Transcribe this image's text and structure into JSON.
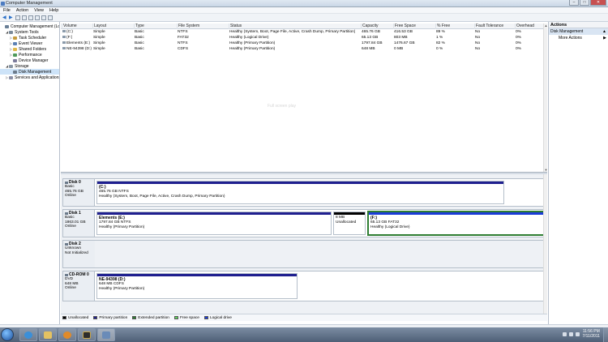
{
  "window": {
    "title": "Computer Management"
  },
  "menu": [
    "File",
    "Action",
    "View",
    "Help"
  ],
  "tree": [
    {
      "label": "Computer Management (Local)",
      "level": 0,
      "expander": "",
      "icon": "computer-icon",
      "color": "#6a7f96"
    },
    {
      "label": "System Tools",
      "level": 1,
      "expander": "◢",
      "icon": "tools-icon",
      "color": "#7a8a9a"
    },
    {
      "label": "Task Scheduler",
      "level": 2,
      "expander": "▷",
      "icon": "clock-icon",
      "color": "#c69b3d"
    },
    {
      "label": "Event Viewer",
      "level": 2,
      "expander": "▷",
      "icon": "event-viewer-icon",
      "color": "#5a80b4"
    },
    {
      "label": "Shared Folders",
      "level": 2,
      "expander": "▷",
      "icon": "folder-icon",
      "color": "#e0b84a"
    },
    {
      "label": "Performance",
      "level": 2,
      "expander": "▷",
      "icon": "performance-icon",
      "color": "#4f9a5a"
    },
    {
      "label": "Device Manager",
      "level": 2,
      "expander": "",
      "icon": "device-manager-icon",
      "color": "#7c7c9c"
    },
    {
      "label": "Storage",
      "level": 1,
      "expander": "◢",
      "icon": "storage-icon",
      "color": "#8a97a6"
    },
    {
      "label": "Disk Management",
      "level": 2,
      "expander": "",
      "icon": "disk-icon",
      "color": "#6c7b8b",
      "selected": true
    },
    {
      "label": "Services and Applications",
      "level": 1,
      "expander": "▷",
      "icon": "services-icon",
      "color": "#8a8fa6"
    }
  ],
  "volume_table": {
    "headers": [
      "Volume",
      "Layout",
      "Type",
      "File System",
      "Status",
      "Capacity",
      "Free Space",
      "% Free",
      "Fault Tolerance",
      "Overhead"
    ],
    "rows": [
      [
        "(C:)",
        "Simple",
        "Basic",
        "NTFS",
        "Healthy (System, Boot, Page File, Active, Crash Dump, Primary Partition)",
        "465.76 GB",
        "416.53 GB",
        "89 %",
        "No",
        "0%"
      ],
      [
        "(F:)",
        "Simple",
        "Basic",
        "FAT32",
        "Healthy (Logical Drive)",
        "65.13 GB",
        "803 MB",
        "1 %",
        "No",
        "0%"
      ],
      [
        "Elements (E:)",
        "Simple",
        "Basic",
        "NTFS",
        "Healthy (Primary Partition)",
        "1797.84 GB",
        "1476.67 GB",
        "82 %",
        "No",
        "0%"
      ],
      [
        "NE-94398 (D:)",
        "Simple",
        "Basic",
        "CDFS",
        "Healthy (Primary Partition)",
        "648 MB",
        "0 MB",
        "0 %",
        "No",
        "0%"
      ]
    ]
  },
  "watermark": "Full screen play",
  "disks": [
    {
      "name": "Disk 0",
      "lines": [
        "Basic",
        "465.76 GB",
        "Online"
      ],
      "partitions": [
        {
          "title": "(C:)",
          "line2": "465.76 GB NTFS",
          "line3": "Healthy (System, Boot, Page File, Active, Crash Dump, Primary Partition)",
          "bar": "primary"
        }
      ]
    },
    {
      "name": "Disk 1",
      "lines": [
        "Basic",
        "1863.01 GB",
        "Online"
      ],
      "partitions": [
        {
          "title": "Elements (E:)",
          "line2": "1797.84 GB NTFS",
          "line3": "Healthy (Primary Partition)",
          "bar": "primary"
        },
        {
          "title": "",
          "line2": "8 MB",
          "line3": "Unallocated",
          "bar": "unallocated"
        },
        {
          "title": "(F:)",
          "line2": "65.13 GB FAT32",
          "line3": "Healthy (Logical Drive)",
          "bar": "logical"
        }
      ]
    },
    {
      "name": "Disk 2",
      "lines": [
        "Unknown",
        "",
        "Not Initialized"
      ],
      "partitions": []
    },
    {
      "name": "CD-ROM 0",
      "lines": [
        "DVD",
        "648 MB",
        "Online"
      ],
      "partitions": [
        {
          "title": "NE-94398 (D:)",
          "line2": "648 MB CDFS",
          "line3": "Healthy (Primary Partition)",
          "bar": "primary"
        }
      ]
    }
  ],
  "legend": [
    {
      "label": "Unallocated",
      "color": "#000000"
    },
    {
      "label": "Primary partition",
      "color": "#1f1f8f"
    },
    {
      "label": "Extended partition",
      "color": "#2e7d32"
    },
    {
      "label": "Free space",
      "color": "#5fd35f"
    },
    {
      "label": "Logical drive",
      "color": "#1a3bd8"
    }
  ],
  "actions": {
    "header": "Actions",
    "section": "Disk Management",
    "item": "More Actions"
  },
  "clock": {
    "time": "11:56 PM",
    "date": "7/11/2011"
  }
}
